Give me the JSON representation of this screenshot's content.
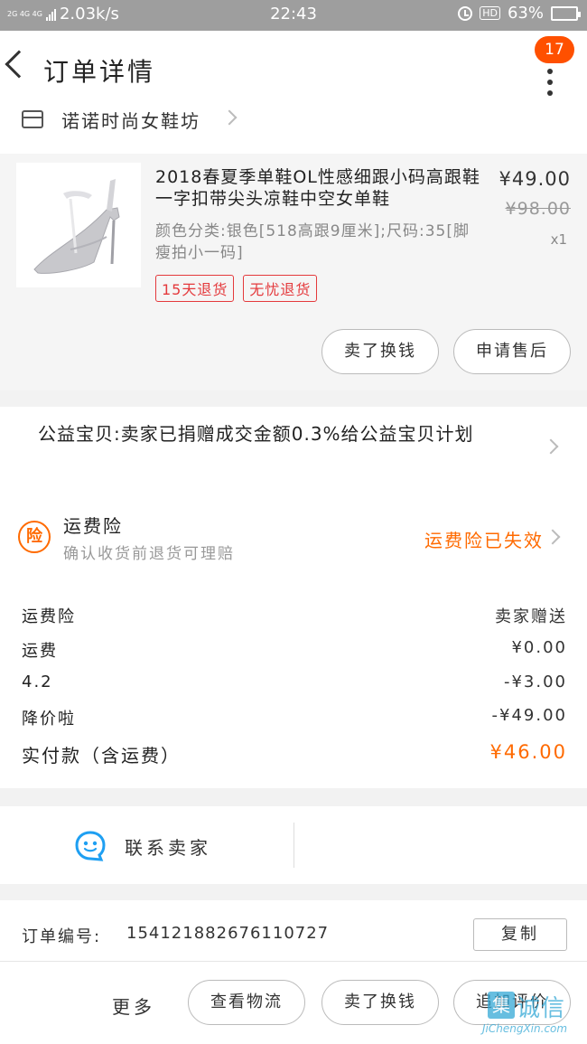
{
  "status_bar": {
    "signal_label": "2G 4G 4G",
    "speed": "2.03k/s",
    "time": "22:43",
    "icons": [
      "alarm-icon",
      "hd-icon",
      "wifi-icon"
    ],
    "hd_label": "HD",
    "battery": "63%",
    "battery_level": 0.63
  },
  "header": {
    "title": "订单详情",
    "badge_count": "17"
  },
  "shop": {
    "name": "诺诺时尚女鞋坊"
  },
  "product": {
    "title": "2018春夏季单鞋OL性感细跟小码高跟鞋一字扣带尖头凉鞋中空女单鞋",
    "spec": "颜色分类:银色[518高跟9厘米];尺码:35[脚瘦拍小一码]",
    "price": "¥49.00",
    "original_price": "¥98.00",
    "quantity": "x1",
    "tags": [
      "15天退货",
      "无忧退货"
    ],
    "actions": {
      "refund": "卖了换钱",
      "after_sale": "申请售后"
    }
  },
  "charity": {
    "text": "公益宝贝:卖家已捐赠成交金额0.3%给公益宝贝计划"
  },
  "insurance": {
    "icon_text": "险",
    "title": "运费险",
    "subtitle": "确认收货前退货可理赔",
    "status": "运费险已失效"
  },
  "fees": [
    {
      "label": "运费险",
      "value": "卖家赠送"
    },
    {
      "label": "运费",
      "value": "¥0.00"
    },
    {
      "label": "4.2",
      "value": "-¥3.00"
    },
    {
      "label": "降价啦",
      "value": "-¥49.00"
    }
  ],
  "total": {
    "label": "实付款（含运费）",
    "value": "¥46.00"
  },
  "contact": {
    "label": "联系卖家"
  },
  "order": {
    "label": "订单编号:",
    "number": "154121882676110727",
    "copy_label": "复制"
  },
  "bottom_bar": {
    "more": "更多",
    "logistics": "查看物流",
    "sell": "卖了换钱",
    "review": "追加评价"
  },
  "watermark": {
    "box_char": "集",
    "text": "诚信",
    "url": "JiChengXin.com"
  },
  "colors": {
    "accent": "#ff6a00",
    "badge": "#ff5000",
    "tag_red": "#e4393c",
    "contact_blue": "#1e9ff2",
    "battery_green": "#4cd964"
  }
}
